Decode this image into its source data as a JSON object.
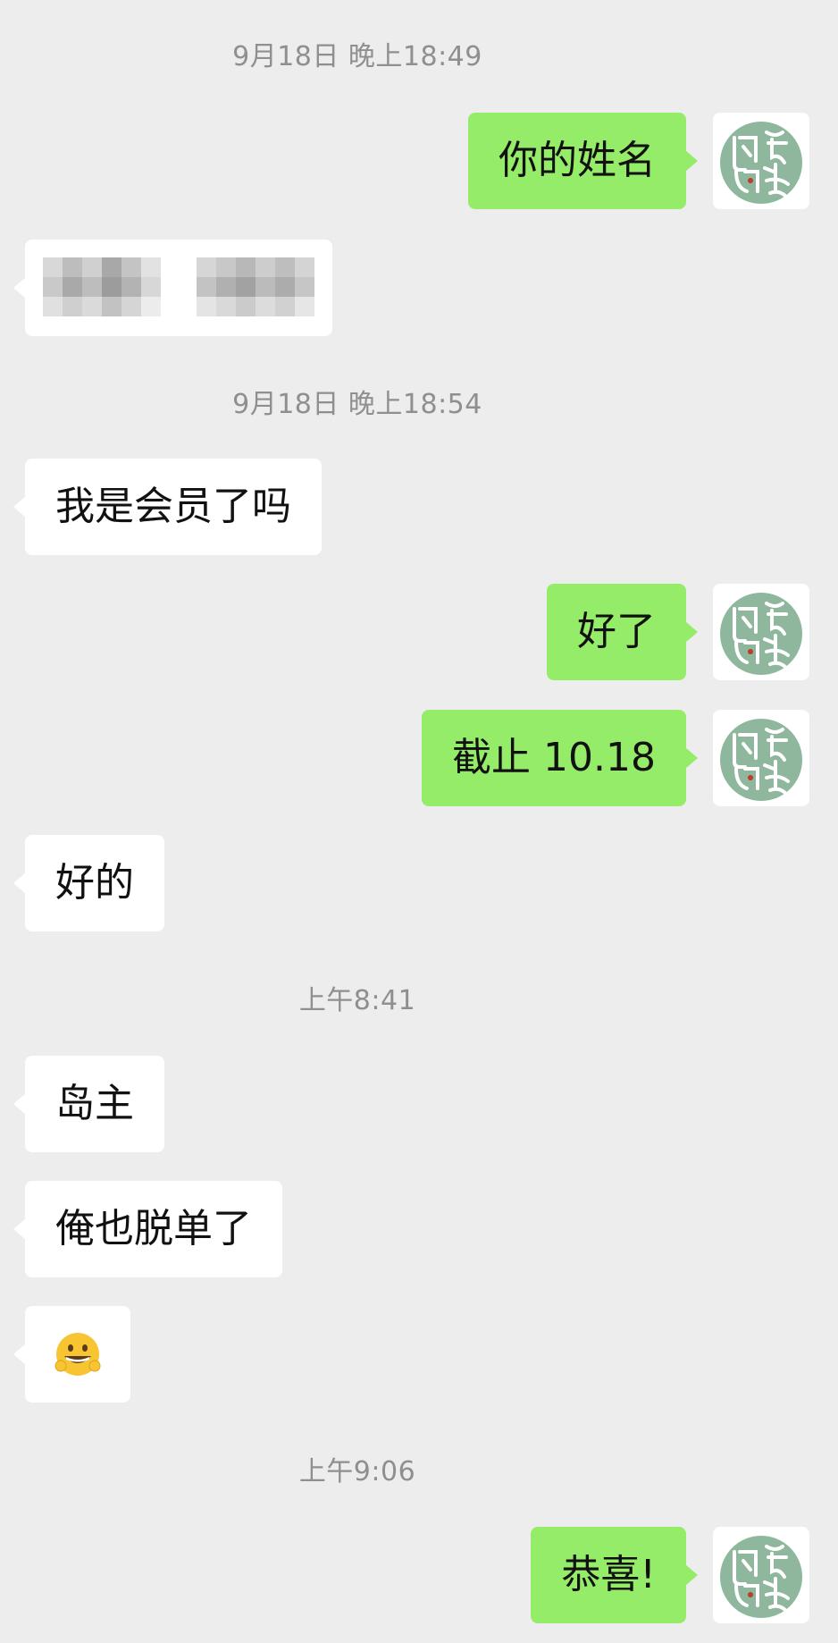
{
  "chat": {
    "timestamps": [
      "9月18日 晚上18:49",
      "9月18日 晚上18:54",
      "上午8:41",
      "上午9:06"
    ],
    "messages": {
      "m1": "你的姓名",
      "m3": "我是会员了吗",
      "m4": "好了",
      "m5": "截止 10.18",
      "m6": "好的",
      "m7": "岛主",
      "m8": "俺也脱单了",
      "m10": "恭喜!"
    },
    "sent_avatar_icon": "calligraphy-logo-icon",
    "redacted_message_icon": "pixelated-redaction-icon",
    "emoji_icon": "grinning-face-emoji-icon"
  },
  "colors": {
    "background": "#ededed",
    "sent_bubble": "#95ec69",
    "received_bubble": "#ffffff",
    "avatar_green": "#8fb79e",
    "timestamp": "#8f8f8f"
  }
}
